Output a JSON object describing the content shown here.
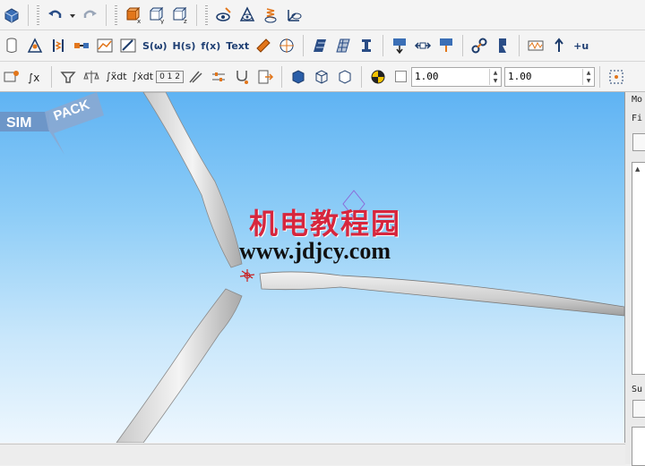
{
  "toolbar1": {
    "icons": [
      "model-icon",
      "undo-icon",
      "undo-dropdown-icon",
      "redo-icon",
      "box-x-icon",
      "box-y-icon",
      "box-z-icon",
      "eye-pen-icon",
      "eye-points-icon",
      "eye-spring-icon",
      "eye-axes-icon"
    ]
  },
  "toolbar2": {
    "text_buttons": {
      "sw": "S(ω)",
      "hs": "H(s)",
      "fx": "f(x)",
      "text": "Text",
      "u": "+u"
    }
  },
  "toolbar3": {
    "buttons": {
      "dt1": "∫x̃dt",
      "dt2": "∫ẋdt",
      "field": "0 1 2"
    },
    "value1": "1.00",
    "value2": "1.00"
  },
  "viewport": {
    "watermark_cn": "机电教程园",
    "watermark_url": "www.jdjcy.com",
    "logo_left": "SIM",
    "logo_right": "PACK"
  },
  "sidepanel": {
    "label_top": "Mo",
    "label_filter": "Fi",
    "label_bottom": "Su"
  },
  "colors": {
    "sky_top": "#5fb3f3",
    "sky_bottom": "#eef7fe",
    "watermark_red": "#d7263d",
    "toolbar_bg": "#f4f4f4"
  }
}
